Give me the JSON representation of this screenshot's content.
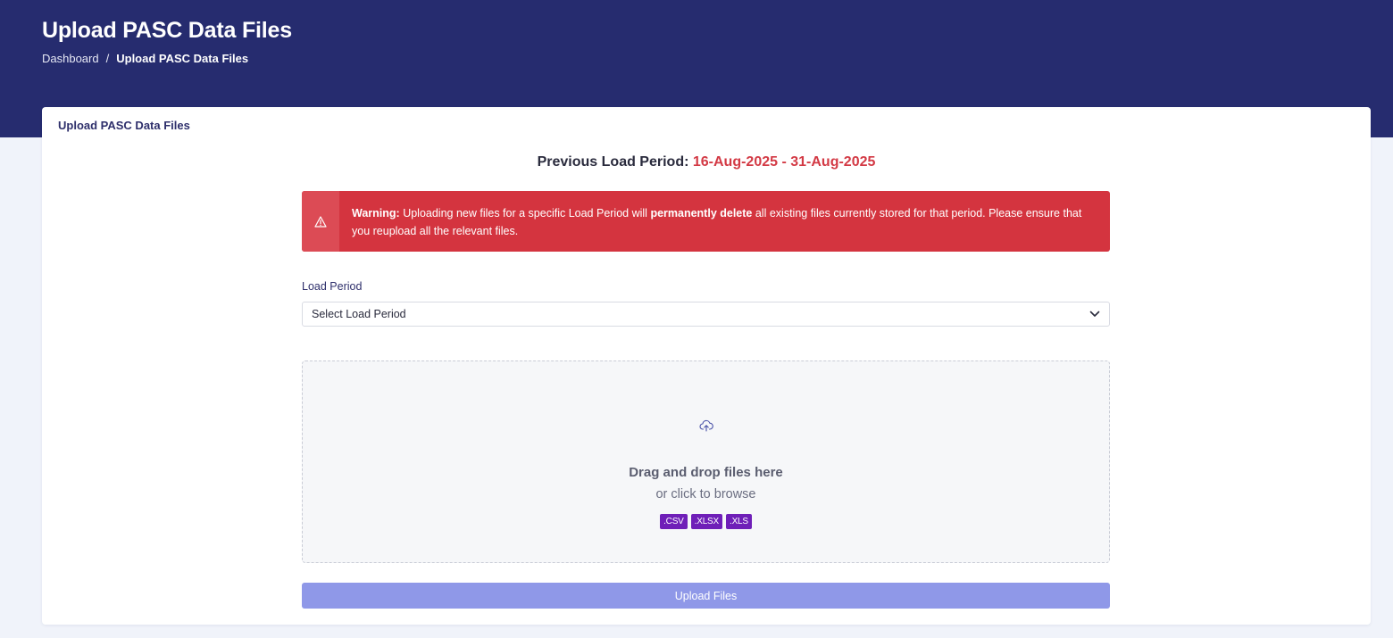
{
  "header": {
    "title": "Upload PASC Data Files",
    "breadcrumb": {
      "home": "Dashboard",
      "separator": "/",
      "current": "Upload PASC Data Files"
    }
  },
  "card": {
    "title": "Upload PASC Data Files",
    "previous_period": {
      "label": "Previous Load Period:",
      "value": "16-Aug-2025 - 31-Aug-2025"
    },
    "warning": {
      "icon": "warning-triangle-icon",
      "lead": "Warning:",
      "text_1": "Uploading new files for a specific Load Period will",
      "emphasis": "permanently delete",
      "text_2": "all existing files currently stored for that period. Please ensure that you reupload all the relevant files."
    },
    "load_period": {
      "label": "Load Period",
      "selected": "Select Load Period",
      "icon": "chevron-down-icon"
    },
    "dropzone": {
      "icon": "cloud-upload-icon",
      "main_text": "Drag and drop files here",
      "sub_text": "or click to browse",
      "file_types": [
        ".CSV",
        ".XLSX",
        ".XLS"
      ]
    },
    "upload_button": "Upload Files"
  },
  "colors": {
    "header_bg": "#262c6f",
    "page_bg": "#f0f3fa",
    "alert_bg": "#d4343f",
    "period_value": "#d33a45",
    "badge_bg": "#6f1fb8",
    "button_bg": "#8f98e8"
  }
}
